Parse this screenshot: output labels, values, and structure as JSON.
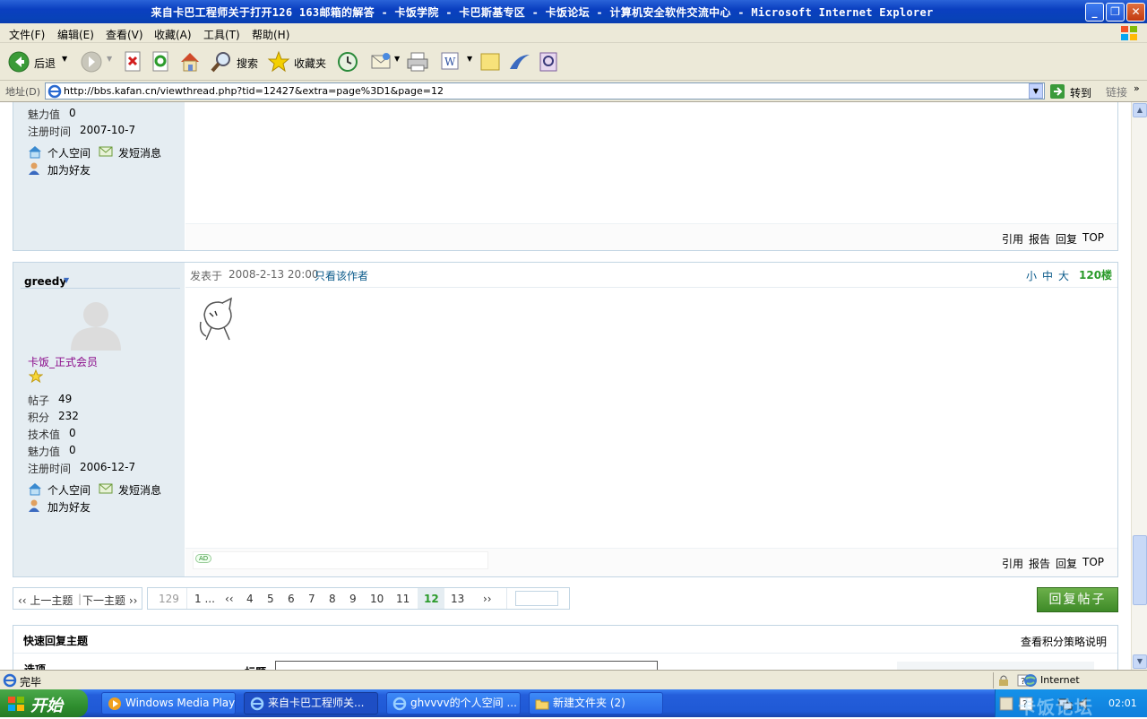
{
  "window": {
    "title": "来自卡巴工程师关于打开126 163邮箱的解答 - 卡饭学院 - 卡巴斯基专区 - 卡饭论坛 - 计算机安全软件交流中心 - Microsoft Internet Explorer"
  },
  "menu": [
    "文件(F)",
    "编辑(E)",
    "查看(V)",
    "收藏(A)",
    "工具(T)",
    "帮助(H)"
  ],
  "toolbar": {
    "back": "后退",
    "search": "搜索",
    "favorites": "收藏夹"
  },
  "address": {
    "label": "地址(D)",
    "url": "http://bbs.kafan.cn/viewthread.php?tid=12427&extra=page%3D1&page=12",
    "go": "转到",
    "links": "链接"
  },
  "post1": {
    "fields": [
      {
        "label": "魅力值",
        "value": "0"
      },
      {
        "label": "注册时间",
        "value": "2007-10-7"
      }
    ],
    "space": "个人空间",
    "pm": "发短消息",
    "friend": "加为好友",
    "actions": [
      "引用",
      "报告",
      "回复",
      "TOP"
    ]
  },
  "post2": {
    "author": "greedy",
    "posted_prefix": "发表于",
    "posted_time": "2008-2-13 20:00",
    "only_author": "只看该作者",
    "sizes": [
      "小",
      "中",
      "大"
    ],
    "floor": "120楼",
    "group": "卡饭_正式会员",
    "fields": [
      {
        "label": "帖子",
        "value": "49"
      },
      {
        "label": "积分",
        "value": "232"
      },
      {
        "label": "技术值",
        "value": "0"
      },
      {
        "label": "魅力值",
        "value": "0"
      },
      {
        "label": "注册时间",
        "value": "2006-12-7"
      }
    ],
    "space": "个人空间",
    "pm": "发短消息",
    "friend": "加为好友",
    "ad": "AD",
    "actions": [
      "引用",
      "报告",
      "回复",
      "TOP"
    ]
  },
  "nav": {
    "prev": "‹‹ 上一主题",
    "sep": "|",
    "next": "下一主题 ››"
  },
  "pager": {
    "total": "129",
    "first": "1 ...",
    "prev": "‹‹",
    "pages": [
      "4",
      "5",
      "6",
      "7",
      "8",
      "9",
      "10",
      "11",
      "12",
      "13"
    ],
    "current": "12",
    "next": "››"
  },
  "reply_button": "回复帖子",
  "quick_reply": {
    "title": "快速回复主题",
    "policy": "查看积分策略说明",
    "options": "选项",
    "subject": "标题"
  },
  "status": {
    "text": "完毕",
    "zone": "Internet"
  },
  "taskbar": {
    "start": "开始",
    "tasks": [
      "Windows Media Player",
      "来自卡巴工程师关...",
      "ghvvvv的个人空间 ...",
      "新建文件夹 (2)"
    ],
    "time": "02:01",
    "watermark": "卡饭论坛"
  }
}
